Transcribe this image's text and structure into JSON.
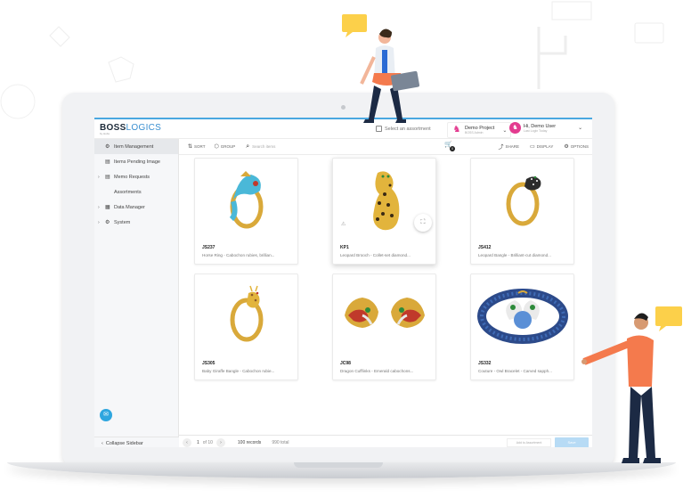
{
  "brand": {
    "logo_bold": "BOSS",
    "logo_light": "LOGICS",
    "logo_sub": "by Hubs"
  },
  "header": {
    "assortment_label": "Select an assortment",
    "project_name": "Demo Project",
    "project_sub": "BOSS Admin",
    "user_name": "Hi, Demo User",
    "user_sub": "Last Login Today"
  },
  "sidebar": {
    "items": [
      {
        "label": "Item Management",
        "icon": "gear-icon",
        "has_arrow": false,
        "active": true
      },
      {
        "label": "Items Pending Image",
        "icon": "document-icon",
        "has_arrow": false,
        "active": false
      },
      {
        "label": "Memo Requests",
        "icon": "document-icon",
        "has_arrow": true,
        "active": false
      },
      {
        "label": "Assortments",
        "icon": "",
        "has_arrow": false,
        "active": false
      },
      {
        "label": "Data Manager",
        "icon": "clipboard-icon",
        "has_arrow": true,
        "active": false
      },
      {
        "label": "System",
        "icon": "gear-icon",
        "has_arrow": true,
        "active": false
      }
    ],
    "collapse_label": "Collapse Sidebar"
  },
  "toolbar": {
    "sort_label": "SORT",
    "group_label": "GROUP",
    "search_placeholder": "Search items",
    "cart_count": "0",
    "share_label": "SHARE",
    "display_label": "DISPLAY",
    "options_label": "OPTIONS"
  },
  "items": [
    {
      "code": "JS237",
      "description": "Horse Ring - Cabochon rubies, brillian..."
    },
    {
      "code": "KP1",
      "description": "Leopard Brooch - Collet-set diamond..."
    },
    {
      "code": "JS412",
      "description": "Leopard Bangle - Brilliant-cut diamond..."
    },
    {
      "code": "JS305",
      "description": "Baby Giraffe Bangle - Cabochon rubie..."
    },
    {
      "code": "JC98",
      "description": "Dragon Cufflinks - Emerald cabochons..."
    },
    {
      "code": "JS332",
      "description": "Couture - Owl Bracelet - Carved sapph..."
    }
  ],
  "footer": {
    "page": "1",
    "of_pages": "of 10",
    "records": "100 records",
    "total": "990 total",
    "add_to_assortment": "Add to Assortment",
    "save_label": "Save"
  },
  "colors": {
    "accent": "#2ea6df",
    "brand_pink": "#e33b8f",
    "shirt_orange": "#f47a4d",
    "note_yellow": "#fcd04a"
  }
}
